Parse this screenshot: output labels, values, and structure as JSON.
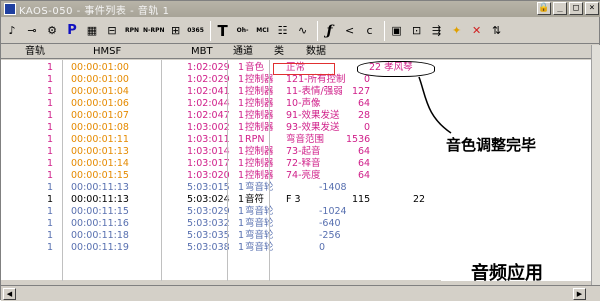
{
  "titlebar": {
    "title": "KAOS-050 - 事件列表 - 音轨 1",
    "buttons": [
      "🔒",
      "_",
      "□",
      "×"
    ]
  },
  "toolbar": {
    "tools": [
      {
        "label": "♪",
        "name": "note-tool"
      },
      {
        "label": "⊸",
        "name": "key-tool"
      },
      {
        "label": "⚙",
        "name": "gear-tool"
      },
      {
        "label": "P",
        "name": "patch-tool"
      },
      {
        "label": "▦",
        "name": "meter-tool"
      },
      {
        "label": "⊟",
        "name": "controller-tool"
      },
      {
        "label": "RPN",
        "name": "rpn-tool"
      },
      {
        "label": "N-RPN",
        "name": "nrpn-tool"
      },
      {
        "label": "⊞",
        "name": "grid-tool"
      },
      {
        "label": "0365",
        "name": "bpm-tool"
      },
      {
        "label": "T",
        "name": "text-tool"
      },
      {
        "label": "Oh-",
        "name": "oh-tool"
      },
      {
        "label": "MCI",
        "name": "mci-tool"
      },
      {
        "label": "☷",
        "name": "filter-tool"
      },
      {
        "label": "∿",
        "name": "wave-tool"
      },
      {
        "label": "ƒ",
        "name": "function-tool"
      },
      {
        "label": "<",
        "name": "less-tool"
      },
      {
        "label": "c",
        "name": "c-tool"
      },
      {
        "label": "▣",
        "name": "frame-tool"
      },
      {
        "label": "⊡",
        "name": "stack-tool"
      },
      {
        "label": "⇶",
        "name": "insert-tool"
      },
      {
        "label": "✦",
        "name": "star-tool"
      },
      {
        "label": "✕",
        "name": "delete-tool"
      },
      {
        "label": "⇅",
        "name": "sort-tool"
      }
    ]
  },
  "columns": [
    "音轨",
    "HMSF",
    "MBT",
    "通道",
    "类",
    "数据"
  ],
  "rows": [
    {
      "track": "1",
      "hmsf": "00:00:01:00",
      "mbt": "1:02:029",
      "ch": "1",
      "kind": "音色",
      "data": "正常",
      "v1": "",
      "v2": "22 孝风琴",
      "c": "pink"
    },
    {
      "track": "1",
      "hmsf": "00:00:01:00",
      "mbt": "1:02:029",
      "ch": "1",
      "kind": "控制器",
      "data": "121-所有控制",
      "v1": "0",
      "v2": "",
      "c": "pink"
    },
    {
      "track": "1",
      "hmsf": "00:00:01:04",
      "mbt": "1:02:041",
      "ch": "1",
      "kind": "控制器",
      "data": "11-表情/强弱",
      "v1": "127",
      "v2": "",
      "c": "pink"
    },
    {
      "track": "1",
      "hmsf": "00:00:01:06",
      "mbt": "1:02:044",
      "ch": "1",
      "kind": "控制器",
      "data": "10-声像",
      "v1": "64",
      "v2": "",
      "c": "pink"
    },
    {
      "track": "1",
      "hmsf": "00:00:01:07",
      "mbt": "1:02:047",
      "ch": "1",
      "kind": "控制器",
      "data": "91-效果发送",
      "v1": "28",
      "v2": "",
      "c": "pink"
    },
    {
      "track": "1",
      "hmsf": "00:00:01:08",
      "mbt": "1:03:002",
      "ch": "1",
      "kind": "控制器",
      "data": "93-效果发送",
      "v1": "0",
      "v2": "",
      "c": "pink"
    },
    {
      "track": "1",
      "hmsf": "00:00:01:11",
      "mbt": "1:03:011",
      "ch": "1",
      "kind": "RPN",
      "data": "弯音范围",
      "v1": "1536",
      "v2": "",
      "c": "pink"
    },
    {
      "track": "1",
      "hmsf": "00:00:01:13",
      "mbt": "1:03:014",
      "ch": "1",
      "kind": "控制器",
      "data": "73-起音",
      "v1": "64",
      "v2": "",
      "c": "pink"
    },
    {
      "track": "1",
      "hmsf": "00:00:01:14",
      "mbt": "1:03:017",
      "ch": "1",
      "kind": "控制器",
      "data": "72-释音",
      "v1": "64",
      "v2": "",
      "c": "pink"
    },
    {
      "track": "1",
      "hmsf": "00:00:01:15",
      "mbt": "1:03:020",
      "ch": "1",
      "kind": "控制器",
      "data": "74-亮度",
      "v1": "64",
      "v2": "",
      "c": "pink"
    },
    {
      "track": "1",
      "hmsf": "00:00:11:13",
      "mbt": "5:03:015",
      "ch": "1",
      "kind": "弯音轮",
      "data": "-1408",
      "v1": "",
      "v2": "",
      "c": "blue"
    },
    {
      "track": "1",
      "hmsf": "00:00:11:13",
      "mbt": "5:03:024",
      "ch": "1",
      "kind": "音符",
      "data": "F 3",
      "v1": "115",
      "v2": "22",
      "c": "dark"
    },
    {
      "track": "1",
      "hmsf": "00:00:11:15",
      "mbt": "5:03:029",
      "ch": "1",
      "kind": "弯音轮",
      "data": "-1024",
      "v1": "",
      "v2": "",
      "c": "blue"
    },
    {
      "track": "1",
      "hmsf": "00:00:11:16",
      "mbt": "5:03:032",
      "ch": "1",
      "kind": "弯音轮",
      "data": "-640",
      "v1": "",
      "v2": "",
      "c": "blue"
    },
    {
      "track": "1",
      "hmsf": "00:00:11:18",
      "mbt": "5:03:035",
      "ch": "1",
      "kind": "弯音轮",
      "data": "-256",
      "v1": "",
      "v2": "",
      "c": "blue"
    },
    {
      "track": "1",
      "hmsf": "00:00:11:19",
      "mbt": "5:03:038",
      "ch": "1",
      "kind": "弯音轮",
      "data": "0",
      "v1": "",
      "v2": "",
      "c": "blue"
    }
  ],
  "annotation": "音色调整完毕",
  "watermark": "音频应用",
  "colors": {
    "pink": "#d0208a",
    "orange": "#e58a00",
    "blue": "#5870b0",
    "selection": "#e03030"
  }
}
